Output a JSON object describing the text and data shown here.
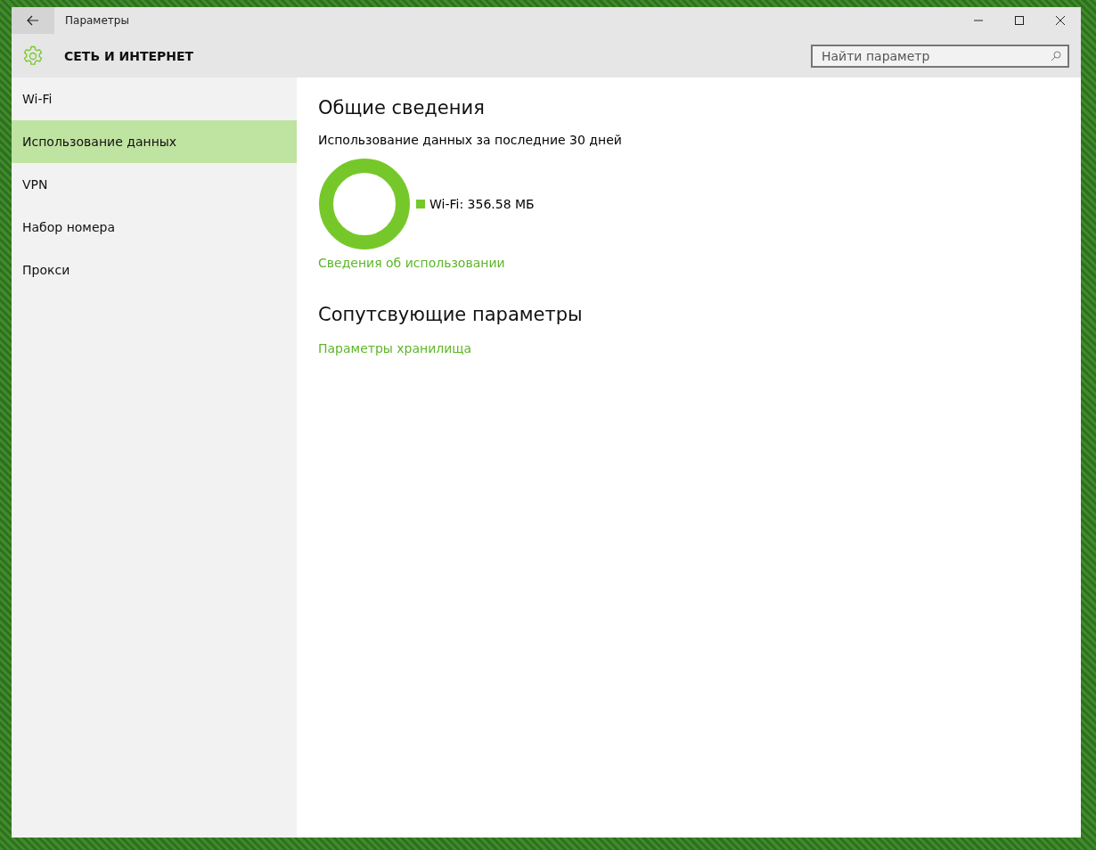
{
  "window": {
    "title": "Параметры"
  },
  "header": {
    "title": "СЕТЬ И ИНТЕРНЕТ"
  },
  "search": {
    "placeholder": "Найти параметр"
  },
  "sidebar": {
    "items": [
      {
        "label": "Wi-Fi",
        "selected": false
      },
      {
        "label": "Использование данных",
        "selected": true
      },
      {
        "label": "VPN",
        "selected": false
      },
      {
        "label": "Набор номера",
        "selected": false
      },
      {
        "label": "Прокси",
        "selected": false
      }
    ]
  },
  "overview": {
    "heading": "Общие сведения",
    "subtitle": "Использование данных за последние 30 дней",
    "legend": [
      {
        "label": "Wi-Fi: 356.58 МБ",
        "color": "#76c82a"
      }
    ],
    "link": "Сведения об использовании"
  },
  "related": {
    "heading": "Сопутсвующие параметры",
    "links": [
      "Параметры хранилища"
    ]
  }
}
